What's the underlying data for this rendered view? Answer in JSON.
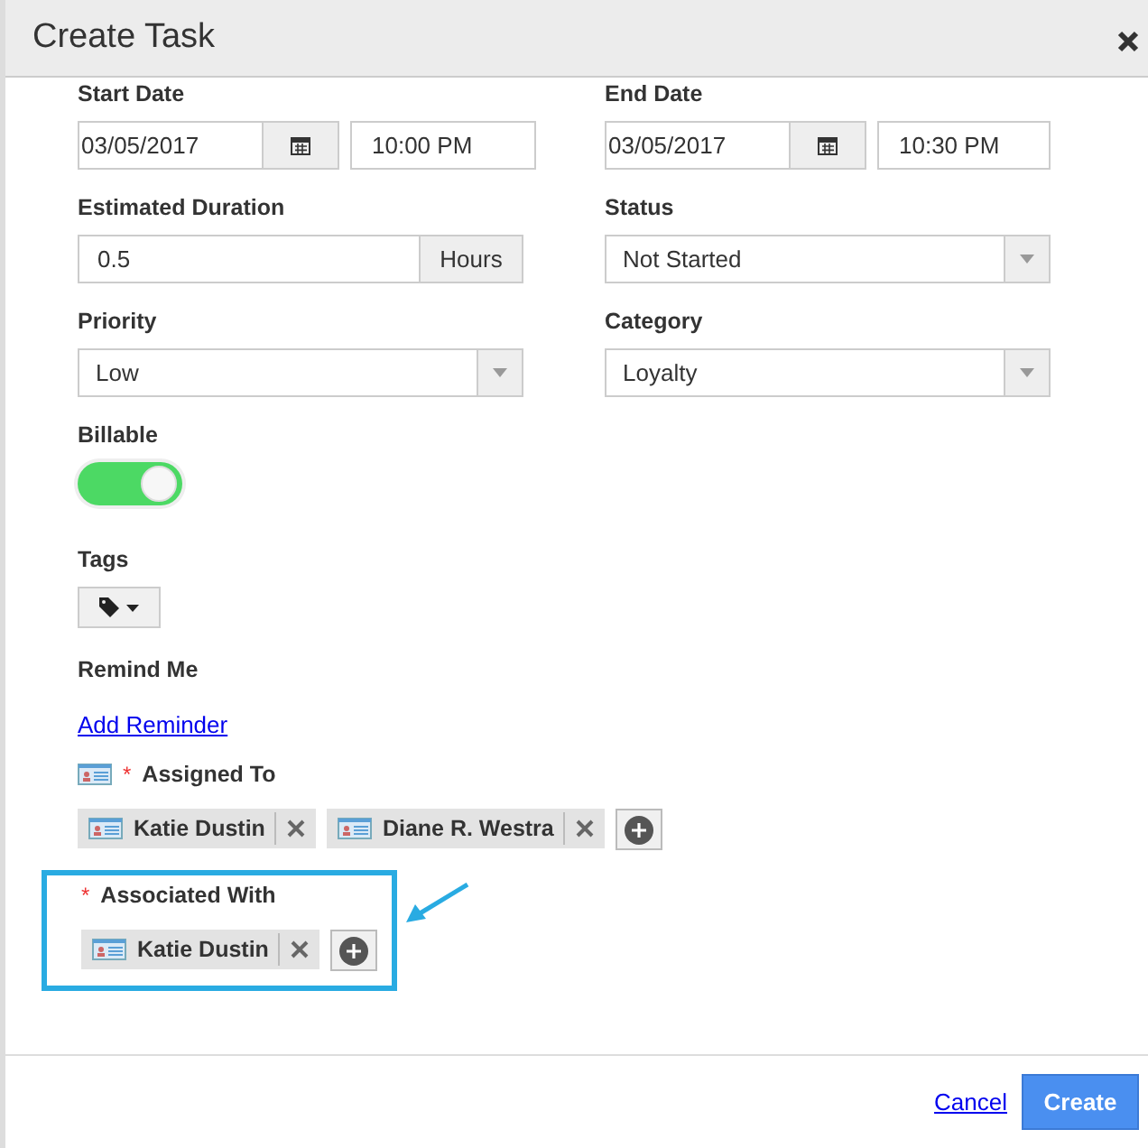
{
  "window": {
    "title": "Create Task"
  },
  "start_date": {
    "label": "Start Date",
    "date": "03/05/2017",
    "time": "10:00 PM"
  },
  "end_date": {
    "label": "End Date",
    "date": "03/05/2017",
    "time": "10:30 PM"
  },
  "estimated_duration": {
    "label": "Estimated Duration",
    "value": "0.5",
    "unit": "Hours"
  },
  "status": {
    "label": "Status",
    "value": "Not Started"
  },
  "priority": {
    "label": "Priority",
    "value": "Low"
  },
  "category": {
    "label": "Category",
    "value": "Loyalty"
  },
  "billable": {
    "label": "Billable",
    "on": true
  },
  "tags": {
    "label": "Tags"
  },
  "remind_me": {
    "label": "Remind Me",
    "link": "Add Reminder"
  },
  "assigned_to": {
    "label": "Assigned To",
    "required_mark": "*",
    "people": [
      "Katie Dustin",
      "Diane R. Westra"
    ]
  },
  "associated_with": {
    "label": "Associated With",
    "required_mark": "*",
    "highlighted": true,
    "people": [
      "Katie Dustin"
    ]
  },
  "buttons": {
    "cancel": "Cancel",
    "create": "Create"
  }
}
